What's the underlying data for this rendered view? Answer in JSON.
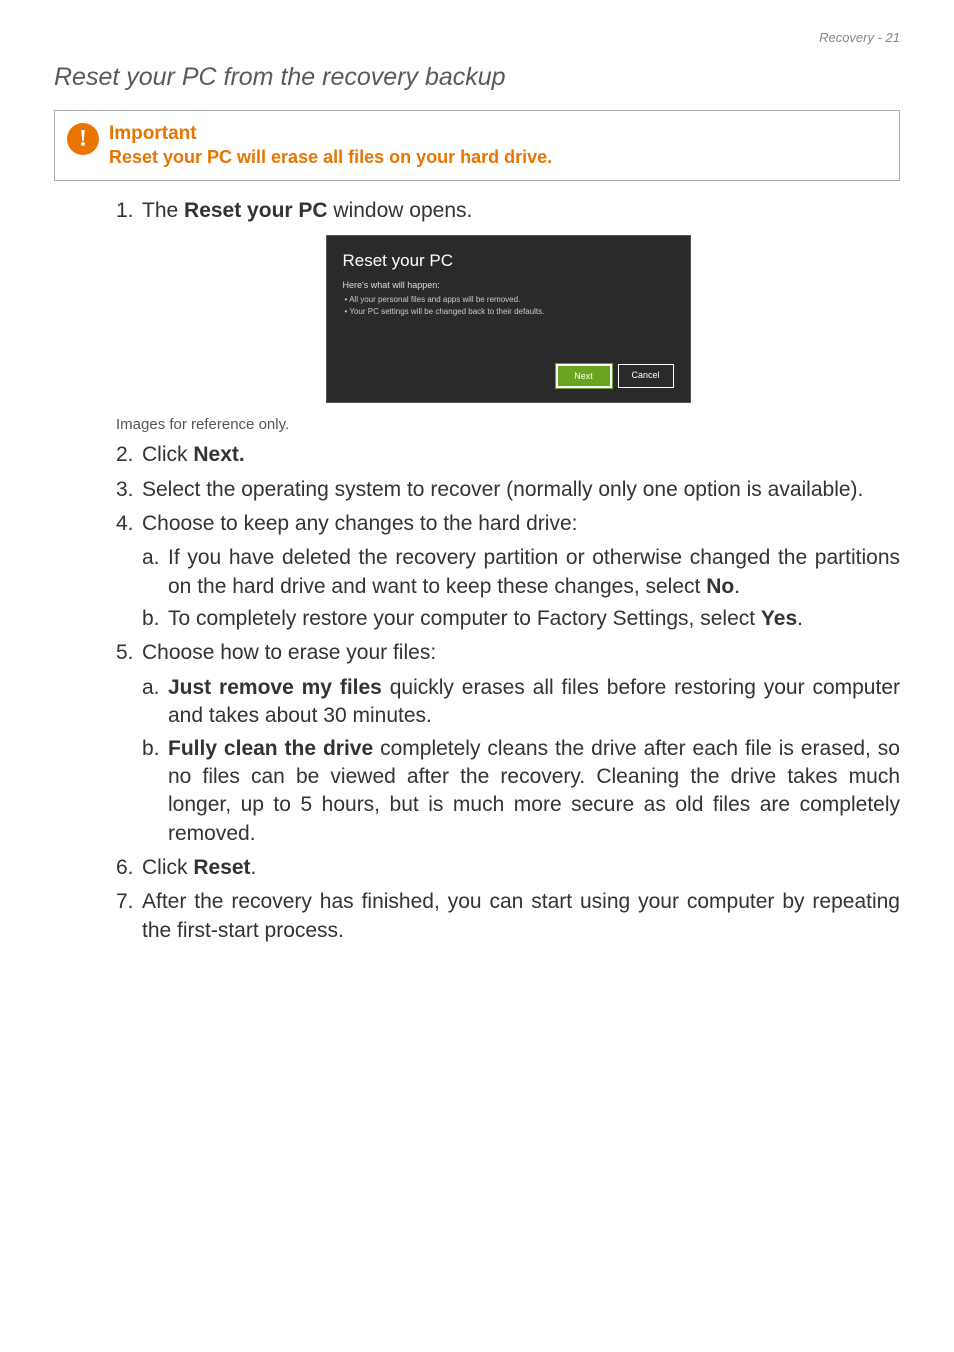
{
  "header": "Recovery - 21",
  "section_title": "Reset your PC from the recovery backup",
  "callout": {
    "icon_glyph": "!",
    "title": "Important",
    "text": "Reset your PC will erase all files on your hard drive."
  },
  "steps": {
    "s1": {
      "num": "1.",
      "prefix": "The ",
      "bold": "Reset your PC",
      "suffix": " window opens."
    },
    "caption": "Images for reference only.",
    "s2": {
      "num": "2.",
      "prefix": "Click ",
      "bold": "Next."
    },
    "s3": {
      "num": "3.",
      "text": "Select the operating system to recover (normally only one option is available)."
    },
    "s4": {
      "num": "4.",
      "text": "Choose to keep any changes to the hard drive:",
      "a": {
        "num": "a.",
        "prefix": "If you have deleted the recovery partition or otherwise changed the partitions on the hard drive and want to keep these changes, select ",
        "bold": "No",
        "suffix": "."
      },
      "b": {
        "num": "b.",
        "prefix": "To completely restore your computer to Factory Settings, select ",
        "bold": "Yes",
        "suffix": "."
      }
    },
    "s5": {
      "num": "5.",
      "text": "Choose how to erase your files:",
      "a": {
        "num": "a.",
        "bold": "Just remove my files",
        "suffix": " quickly erases all files before restoring your computer and takes about 30 minutes."
      },
      "b": {
        "num": "b.",
        "bold": "Fully clean the drive",
        "suffix": " completely cleans the drive after each file is erased, so no files can be viewed after the recovery. Cleaning the drive takes much longer, up to 5 hours, but is much more secure as old files are completely removed."
      }
    },
    "s6": {
      "num": "6.",
      "prefix": "Click ",
      "bold": "Reset",
      "suffix": "."
    },
    "s7": {
      "num": "7.",
      "text": "After the recovery has finished, you can start using your computer by repeating the first-start process."
    }
  },
  "dialog": {
    "title": "Reset your PC",
    "subtitle": "Here's what will happen:",
    "bullet1": "• All your personal files and apps will be removed.",
    "bullet2": "• Your PC settings will be changed back to their defaults.",
    "next": "Next",
    "cancel": "Cancel"
  }
}
